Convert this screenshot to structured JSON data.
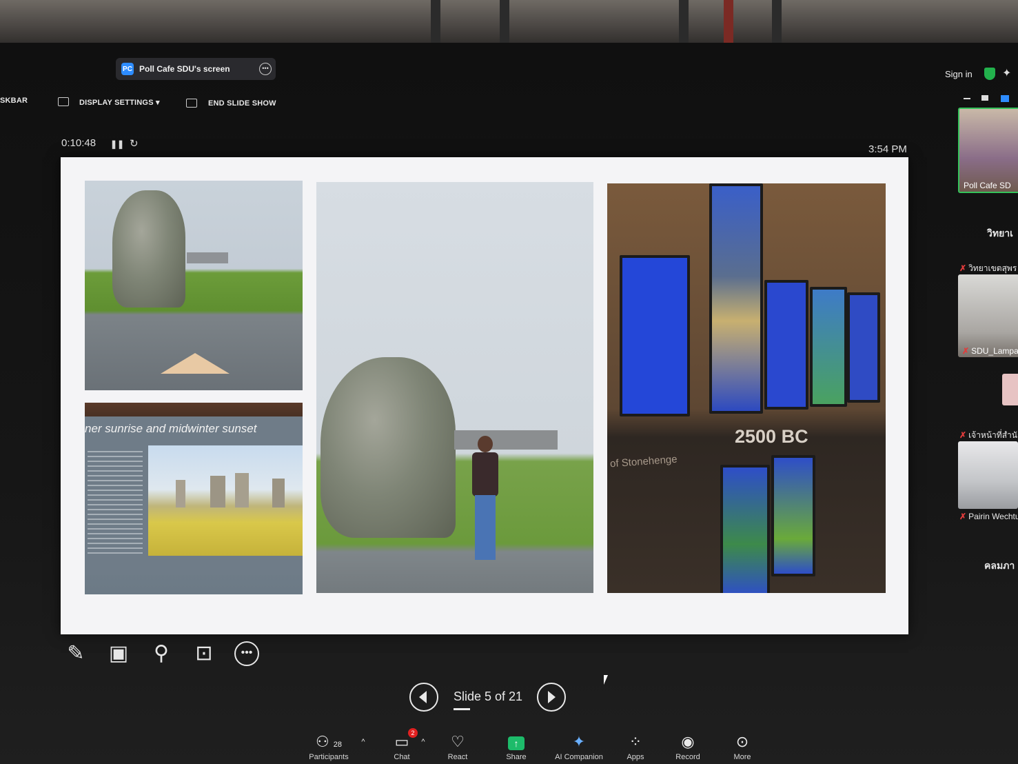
{
  "share": {
    "title": "Poll Cafe SDU's screen",
    "icon": "PC"
  },
  "account": {
    "sign_in": "Sign in"
  },
  "toolbar": {
    "partial_left": "SKBAR",
    "display_settings": "DISPLAY SETTINGS ▾",
    "end_slide_show": "END SLIDE SHOW"
  },
  "presenter": {
    "elapsed": "0:10:48",
    "clock": "3:54 PM"
  },
  "slide": {
    "sign_heading": "ner sunrise and midwinter sunset",
    "year_label": "2500 BC",
    "exhibit_text": "of Stonehenge"
  },
  "navigation": {
    "counter": "Slide 5 of 21"
  },
  "meeting_bar": {
    "participants_label": "Participants",
    "participants_count": "28",
    "chat_label": "Chat",
    "chat_badge": "2",
    "react_label": "React",
    "share_label": "Share",
    "ai_label": "AI Companion",
    "apps_label": "Apps",
    "record_label": "Record",
    "more_label": "More"
  },
  "participants": [
    {
      "name": "Poll Cafe SD"
    },
    {
      "name": "วิทยาเขตสุพร"
    },
    {
      "name": "SDU_Lampar"
    },
    {
      "name": "เจ้าหน้าที่สำนัก"
    },
    {
      "name": "Pairin Wechtu"
    }
  ],
  "side_headings": {
    "first": "วิทยาเ",
    "second": "คลมภา"
  },
  "colors": {
    "accent": "#2d8cff",
    "share_green": "#1dbb6a",
    "badge_red": "#e02020",
    "shield_green": "#22b14c"
  }
}
